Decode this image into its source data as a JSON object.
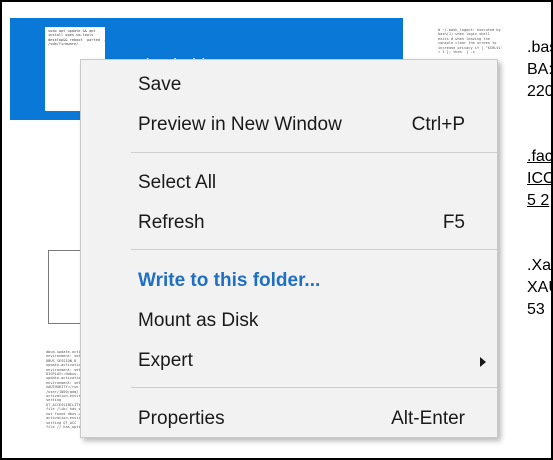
{
  "selected_file": {
    "name": ".bash_history",
    "preview_lines": [
      "sudo apt update && apt",
      "install open-vm-tools",
      "desktop&& reboot  parted  /dev",
      "/sdb/firmware/"
    ]
  },
  "thumb_bash_logout": {
    "preview_lines": [
      "# ~/.bash_logout: executed by",
      "bash(1) when login shell",
      "exits # when leaving the",
      "console clear the screen to",
      "increase privacy if [ \"$SHLVL\"",
      "= 1 ]; then  ] -x"
    ]
  },
  "thumb_xauthority": {
    "preview_lines": [
      "dbus-update-activa",
      "environment: setting",
      "DBUS_SESSION_B",
      "update-activation-",
      "environment: setting",
      "DISPLAY=:0dbus-",
      "update-activation-",
      "environment: setting",
      "XAUTHORITY=/run",
      "/user/1000/gdm/",
      "activation-enviro",
      "setting",
      "QT_ACCESSIBILITY",
      "file /lib/ has_option",
      "not found dbus-upd",
      "activation-enviro",
      "setting QT_ACC",
      "file // has_option"
    ]
  },
  "right_files": [
    {
      "name": ".bas",
      "type": "BA:",
      "size": "220"
    },
    {
      "name": ".fac",
      "type": "ICO",
      "size": "5 2"
    },
    {
      "name": ".Xa",
      "type": "XAU",
      "size": "53"
    }
  ],
  "menu": {
    "save": "Save",
    "preview": "Preview in New Window",
    "preview_key": "Ctrl+P",
    "select_all": "Select All",
    "refresh": "Refresh",
    "refresh_key": "F5",
    "write": "Write to this folder...",
    "mount": "Mount as Disk",
    "expert": "Expert",
    "properties": "Properties",
    "properties_key": "Alt-Enter",
    "accent_color": "#1f6fc2"
  }
}
